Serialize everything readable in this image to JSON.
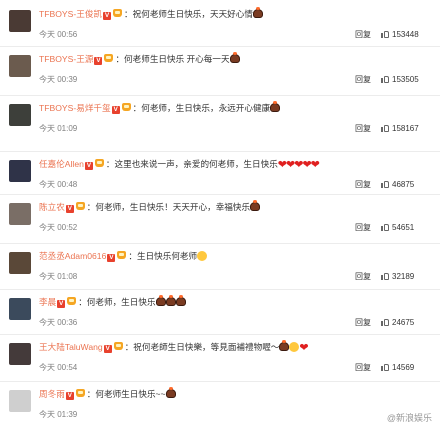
{
  "comments": [
    {
      "name": "TFBOYS-王俊凯",
      "text": "：祝何老师生日快乐，天天好心情",
      "emoji": [
        "cake"
      ],
      "time": "今天 00:56",
      "reply": "回复",
      "likes": "153448"
    },
    {
      "name": "TFBOYS-王源",
      "text": "：何老师生日快乐  开心每一天",
      "emoji": [
        "cake"
      ],
      "time": "今天 00:39",
      "reply": "回复",
      "likes": "153505"
    },
    {
      "name": "TFBOYS-易烊千玺",
      "text": "：何老师，生日快乐，永远开心健康",
      "emoji": [
        "cake"
      ],
      "time": "今天 01:09",
      "reply": "回复",
      "likes": "158167"
    },
    {
      "name": "任嘉伦Allen",
      "text": "：这里也来说一声，亲爱的何老师，生日快乐",
      "emoji": [
        "heart",
        "heart",
        "heart",
        "heart",
        "heart"
      ],
      "time": "今天 00:48",
      "reply": "回复",
      "likes": "46875"
    },
    {
      "name": "陈立农",
      "text": "：何老师，生日快乐！天天开心，幸福快乐",
      "emoji": [
        "cake"
      ],
      "time": "今天 00:52",
      "reply": "回复",
      "likes": "54651"
    },
    {
      "name": "范丞丞Adam0616",
      "text": "：生日快乐何老师",
      "emoji": [
        "smile"
      ],
      "time": "今天 01:08",
      "reply": "回复",
      "likes": "32189"
    },
    {
      "name": "李晨",
      "text": "：何老师，生日快乐",
      "emoji": [
        "cake",
        "cake",
        "cake"
      ],
      "time": "今天 00:36",
      "reply": "回复",
      "likes": "24675"
    },
    {
      "name": "王大陆TaluWang",
      "text": "：祝何老師生日快樂，等見面補禮物喔～",
      "emoji": [
        "cake",
        "smile",
        "heart"
      ],
      "time": "今天 00:54",
      "reply": "回复",
      "likes": "14569"
    },
    {
      "name": "周冬雨",
      "text": "：何老师生日快乐~~",
      "emoji": [
        "cake"
      ],
      "time": "今天 01:39",
      "reply": "",
      "likes": ""
    }
  ],
  "watermark": "@新浪娱乐"
}
